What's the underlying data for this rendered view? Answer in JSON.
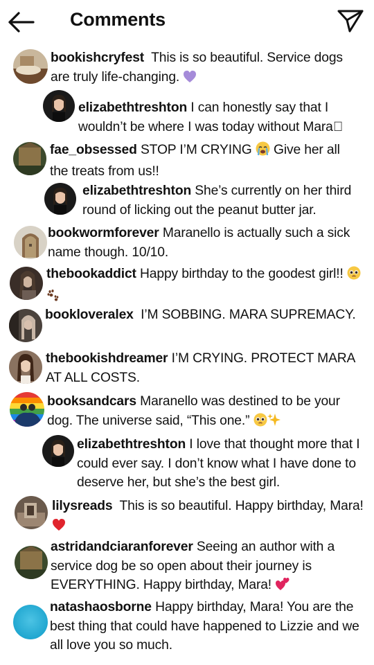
{
  "header": {
    "title": "Comments"
  },
  "comments": [
    {
      "user": "bookishcryfest",
      "text": "This is so beautiful. Service dogs are truly life-changing.",
      "emoji": "purple-heart"
    },
    {
      "user": "elizabethtreshton",
      "text": "I can honestly say that I wouldn’t be where I was today without Mara⃞",
      "emoji": ""
    },
    {
      "user": "fae_obsessed",
      "text": "STOP I’M CRYING",
      "text2": "Give her all the treats from us!!",
      "emoji": "crying-face"
    },
    {
      "user": "elizabethtreshton",
      "text": "She’s currently on her third round of licking out the peanut butter jar.",
      "emoji": ""
    },
    {
      "user": "bookwormforever",
      "text": "Maranello is actually such a sick name though. 10/10.",
      "emoji": ""
    },
    {
      "user": "thebookaddict",
      "text": "Happy birthday to the goodest girl!!",
      "emoji": "pleading-face paw-prints"
    },
    {
      "user": "bookloveralex",
      "text": "I’M SOBBING. MARA SUPREMACY.",
      "emoji": ""
    },
    {
      "user": "thebookishdreamer",
      "text": "I’M CRYING. PROTECT MARA AT ALL COSTS.",
      "emoji": ""
    },
    {
      "user": "booksandcars",
      "text": "Maranello was destined to be your dog. The universe said, “This one.”",
      "emoji": "pleading-face sparkles"
    },
    {
      "user": "elizabethtreshton",
      "text": "I love that thought more that I could ever say. I don’t know what I have done to deserve her, but she’s the best girl.",
      "emoji": ""
    },
    {
      "user": "lilysreads",
      "text": "This is so beautiful. Happy birthday, Mara!",
      "emoji": "red-heart"
    },
    {
      "user": "astridandciaranforever",
      "text": "Seeing an author with a service dog be so open about their journey is EVERYTHING. Happy birthday, Mara!",
      "emoji": "two-hearts"
    },
    {
      "user": "natashaosborne",
      "text": "Happy birthday, Mara! You are the best thing that could have happened to Lizzie and we all love you so much.",
      "emoji": ""
    }
  ],
  "colors": {
    "text": "#111111",
    "background": "#ffffff",
    "purple_heart": "#a58bd9",
    "red_heart": "#e0242d"
  }
}
